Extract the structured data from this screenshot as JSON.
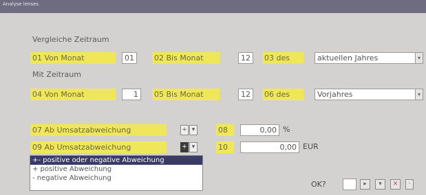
{
  "window": {
    "title": "Analyse lenses"
  },
  "section_compare": {
    "label": "Vergleiche Zeitraum"
  },
  "row1": {
    "field1_label": "01 Von Monat",
    "field1_value": "01",
    "field2_label": "02 Bis Monat",
    "field2_value": "12",
    "field3_label": "03 des",
    "field3_value": "aktuellen Jahres"
  },
  "section_with": {
    "label": "Mit Zeitraum"
  },
  "row2": {
    "field4_label": "04 Von Monat",
    "field4_value": "1",
    "field5_label": "05 Bis Monat",
    "field5_value": "12",
    "field6_label": "06 des",
    "field6_value": "Vorjahres"
  },
  "row3": {
    "field7_label": "07 Ab Umsatzabweichung",
    "sign7": "+",
    "field8_label": "08",
    "field8_value": "0,00",
    "unit8": "%"
  },
  "row4": {
    "field9_label": "09 Ab Umsatzabweichung",
    "sign9": "+",
    "field10_label": "10",
    "field10_value": "0,00",
    "unit10": "EUR"
  },
  "dropdown": {
    "options": [
      "+- positive oder negative Abweichung",
      "+  positive Abweichung",
      "-  negative Abweichung"
    ]
  },
  "footer": {
    "ok_label": "OK?"
  },
  "colors": {
    "highlight": "#f0e65a",
    "titlebar": "#6f6c82",
    "selection": "#3a3a66"
  }
}
